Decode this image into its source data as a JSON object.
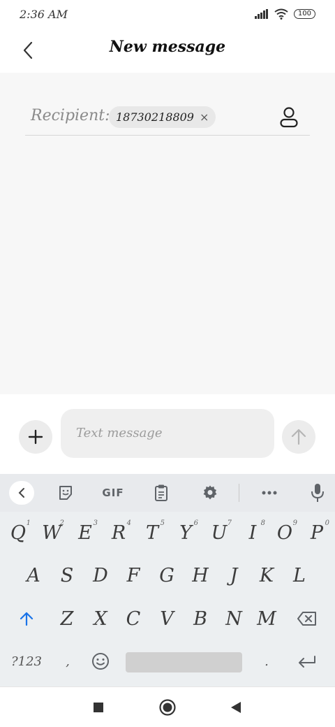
{
  "status_bar": {
    "time": "2:36 AM",
    "battery": "100"
  },
  "header": {
    "title": "New message",
    "back_icon": "chevron-left-icon"
  },
  "recipient": {
    "label": "Recipient:",
    "chip_number": "18730218809",
    "chip_close": "×",
    "contact_icon": "person-icon"
  },
  "compose": {
    "placeholder": "Text message",
    "add_icon": "plus-icon",
    "send_icon": "arrow-up-icon"
  },
  "keyboard": {
    "toolbar": {
      "gif": "GIF"
    },
    "row1": [
      {
        "k": "Q",
        "n": "1"
      },
      {
        "k": "W",
        "n": "2"
      },
      {
        "k": "E",
        "n": "3"
      },
      {
        "k": "R",
        "n": "4"
      },
      {
        "k": "T",
        "n": "5"
      },
      {
        "k": "Y",
        "n": "6"
      },
      {
        "k": "U",
        "n": "7"
      },
      {
        "k": "I",
        "n": "8"
      },
      {
        "k": "O",
        "n": "9"
      },
      {
        "k": "P",
        "n": "0"
      }
    ],
    "row2": [
      "A",
      "S",
      "D",
      "F",
      "G",
      "H",
      "J",
      "K",
      "L"
    ],
    "row3": [
      "Z",
      "X",
      "C",
      "V",
      "B",
      "N",
      "M"
    ],
    "symbols_key": "?123",
    "comma_key": ",",
    "period_key": "."
  }
}
